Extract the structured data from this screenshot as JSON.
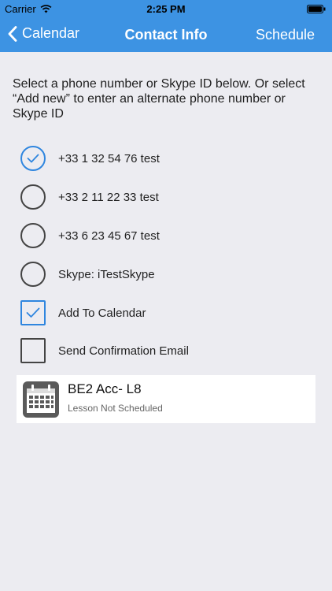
{
  "status_bar": {
    "carrier": "Carrier",
    "time": "2:25 PM"
  },
  "nav": {
    "back_label": "Calendar",
    "title": "Contact Info",
    "right_label": "Schedule"
  },
  "instructions": "Select a phone number or Skype ID below. Or select “Add new” to enter an alternate phone number or Skype ID",
  "options": [
    {
      "label": "+33 1 32 54 76 test",
      "selected": true
    },
    {
      "label": "+33 2 11 22 33 test",
      "selected": false
    },
    {
      "label": "+33 6 23 45 67 test",
      "selected": false
    },
    {
      "label": "Skype: iTestSkype",
      "selected": false
    }
  ],
  "checkboxes": [
    {
      "label": "Add To Calendar",
      "checked": true
    },
    {
      "label": "Send Confirmation Email",
      "checked": false
    }
  ],
  "lesson": {
    "title": "BE2 Acc- L8",
    "status": "Lesson Not Scheduled"
  },
  "colors": {
    "accent": "#3d93e3",
    "check": "#2f86df",
    "background": "#ececf1"
  }
}
